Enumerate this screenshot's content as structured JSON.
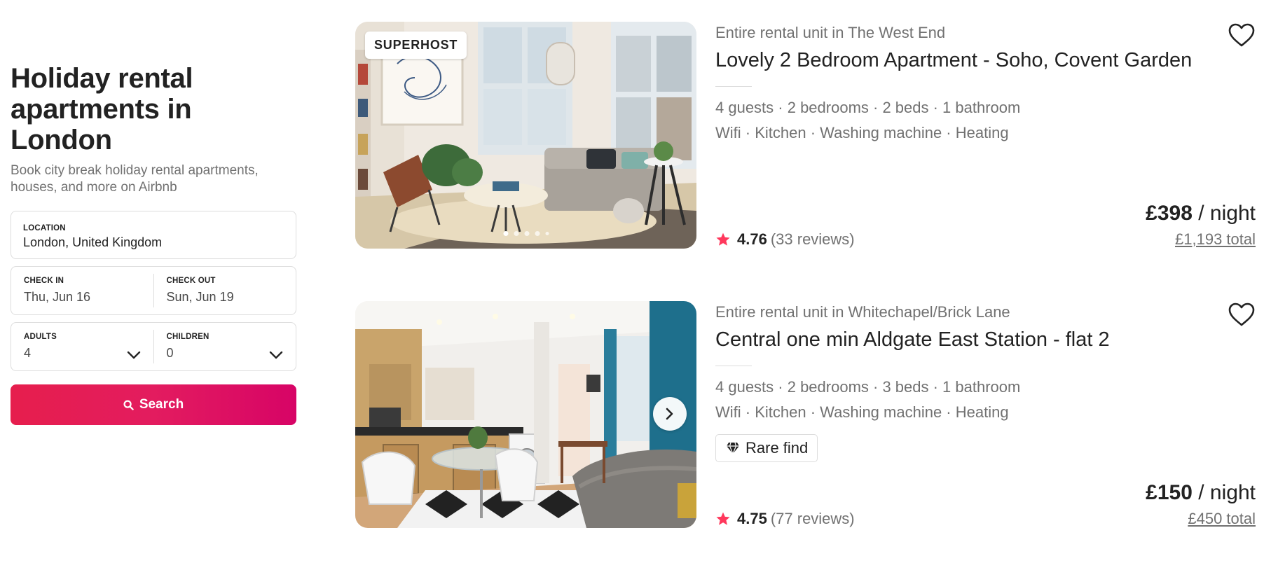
{
  "search": {
    "heading": "Holiday rental apartments in London",
    "subtitle": "Book city break holiday rental apartments, houses, and more on Airbnb",
    "location_label": "LOCATION",
    "location_value": "London, United Kingdom",
    "checkin_label": "CHECK IN",
    "checkin_value": "Thu, Jun 16",
    "checkout_label": "CHECK OUT",
    "checkout_value": "Sun, Jun 19",
    "adults_label": "ADULTS",
    "adults_value": "4",
    "children_label": "CHILDREN",
    "children_value": "0",
    "button_label": "Search",
    "brand_color": "#e31c5f"
  },
  "listings": [
    {
      "badge": "SUPERHOST",
      "type": "Entire rental unit in The West End",
      "title": "Lovely 2 Bedroom Apartment - Soho, Covent Garden",
      "details": "4 guests · 2 bedrooms · 2 beds · 1 bathroom",
      "amenities": "Wifi · Kitchen · Washing machine · Heating",
      "rating": "4.76",
      "reviews": "(33 reviews)",
      "price": "£398",
      "per_night": "/ night",
      "total": "£1,193 total",
      "photo_dots": 5,
      "photo_dot_active": 0
    },
    {
      "type": "Entire rental unit in Whitechapel/Brick Lane",
      "title": "Central one min Aldgate East Station - flat 2",
      "details": "4 guests · 2 bedrooms · 3 beds · 1 bathroom",
      "amenities": "Wifi · Kitchen · Washing machine · Heating",
      "rare_find": "Rare find",
      "rating": "4.75",
      "reviews": "(77 reviews)",
      "price": "£150",
      "per_night": "/ night",
      "total": "£450 total"
    }
  ],
  "icons": {
    "rating_star": "star-icon",
    "favorite": "heart-icon",
    "search": "search-icon",
    "rare_find": "diamond-icon",
    "dropdown": "chevron-down-icon",
    "carousel_next": "chevron-right-icon"
  },
  "colors": {
    "star": "#ff385c",
    "muted_text": "#717171",
    "primary_text": "#222222",
    "border": "#dddddd"
  }
}
